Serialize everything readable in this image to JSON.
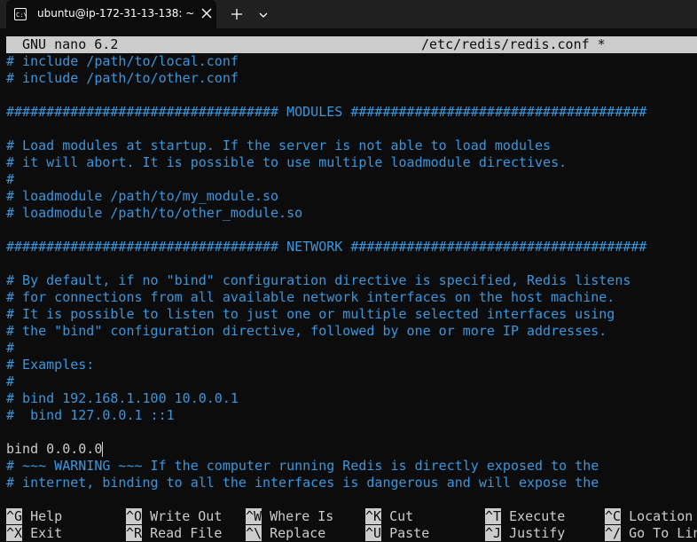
{
  "tab": {
    "title": "ubuntu@ip-172-31-13-138: ~",
    "icon": "terminal-icon"
  },
  "nano": {
    "version": "GNU nano 6.2",
    "file": "/etc/redis/redis.conf *"
  },
  "editor_lines": [
    "# include /path/to/local.conf",
    "# include /path/to/other.conf",
    "",
    "################################## MODULES #####################################",
    "",
    "# Load modules at startup. If the server is not able to load modules",
    "# it will abort. It is possible to use multiple loadmodule directives.",
    "#",
    "# loadmodule /path/to/my_module.so",
    "# loadmodule /path/to/other_module.so",
    "",
    "################################## NETWORK #####################################",
    "",
    "# By default, if no \"bind\" configuration directive is specified, Redis listens",
    "# for connections from all available network interfaces on the host machine.",
    "# It is possible to listen to just one or multiple selected interfaces using",
    "# the \"bind\" configuration directive, followed by one or more IP addresses.",
    "#",
    "# Examples:",
    "#",
    "# bind 192.168.1.100 10.0.0.1",
    "#  bind 127.0.0.1 ::1",
    "",
    "bind 0.0.0.0",
    "# ~~~ WARNING ~~~ If the computer running Redis is directly exposed to the",
    "# internet, binding to all the interfaces is dangerous and will expose the"
  ],
  "shortcuts_row1": [
    {
      "key": "^G",
      "label": "Help"
    },
    {
      "key": "^O",
      "label": "Write Out"
    },
    {
      "key": "^W",
      "label": "Where Is"
    },
    {
      "key": "^K",
      "label": "Cut"
    },
    {
      "key": "^T",
      "label": "Execute"
    },
    {
      "key": "^C",
      "label": "Location"
    }
  ],
  "shortcuts_row2": [
    {
      "key": "^X",
      "label": "Exit"
    },
    {
      "key": "^R",
      "label": "Read File"
    },
    {
      "key": "^\\",
      "label": "Replace"
    },
    {
      "key": "^U",
      "label": "Paste"
    },
    {
      "key": "^J",
      "label": "Justify"
    },
    {
      "key": "^/",
      "label": "Go To Line"
    }
  ],
  "colors": {
    "comment": "#3a96dd",
    "text": "#cccccc",
    "background": "#0c0c0c",
    "tabbar": "#202020"
  }
}
